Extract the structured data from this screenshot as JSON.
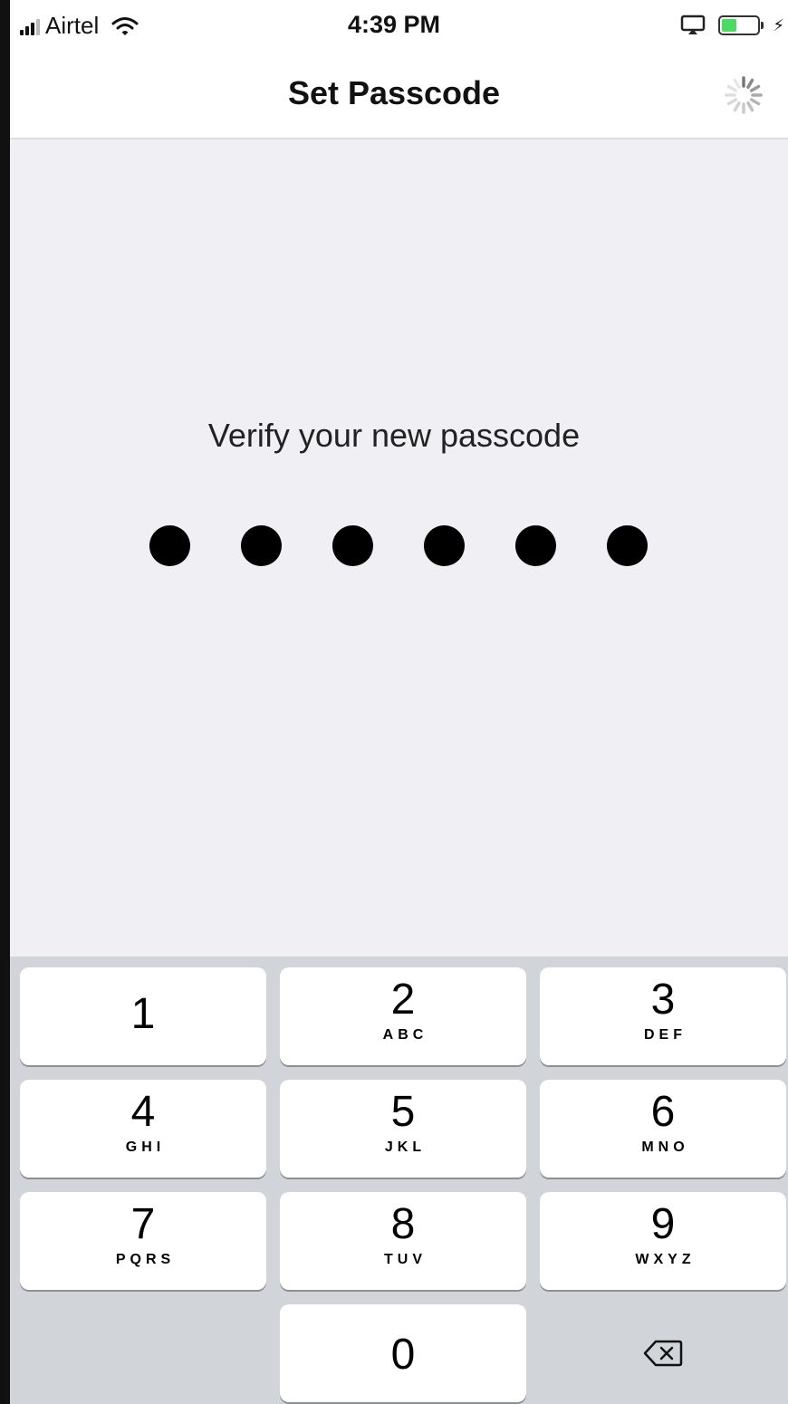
{
  "status_bar": {
    "carrier": "Airtel",
    "time": "4:39 PM",
    "battery_color": "#4cd964"
  },
  "nav": {
    "title": "Set Passcode",
    "activity_icon": "spinner-icon"
  },
  "prompt": "Verify your new passcode",
  "passcode": {
    "length": 6,
    "filled": 6
  },
  "keypad": {
    "keys": [
      {
        "digit": "1",
        "letters": ""
      },
      {
        "digit": "2",
        "letters": "ABC"
      },
      {
        "digit": "3",
        "letters": "DEF"
      },
      {
        "digit": "4",
        "letters": "GHI"
      },
      {
        "digit": "5",
        "letters": "JKL"
      },
      {
        "digit": "6",
        "letters": "MNO"
      },
      {
        "digit": "7",
        "letters": "PQRS"
      },
      {
        "digit": "8",
        "letters": "TUV"
      },
      {
        "digit": "9",
        "letters": "WXYZ"
      },
      {
        "digit": "0",
        "letters": ""
      }
    ],
    "delete_icon": "backspace-icon"
  }
}
